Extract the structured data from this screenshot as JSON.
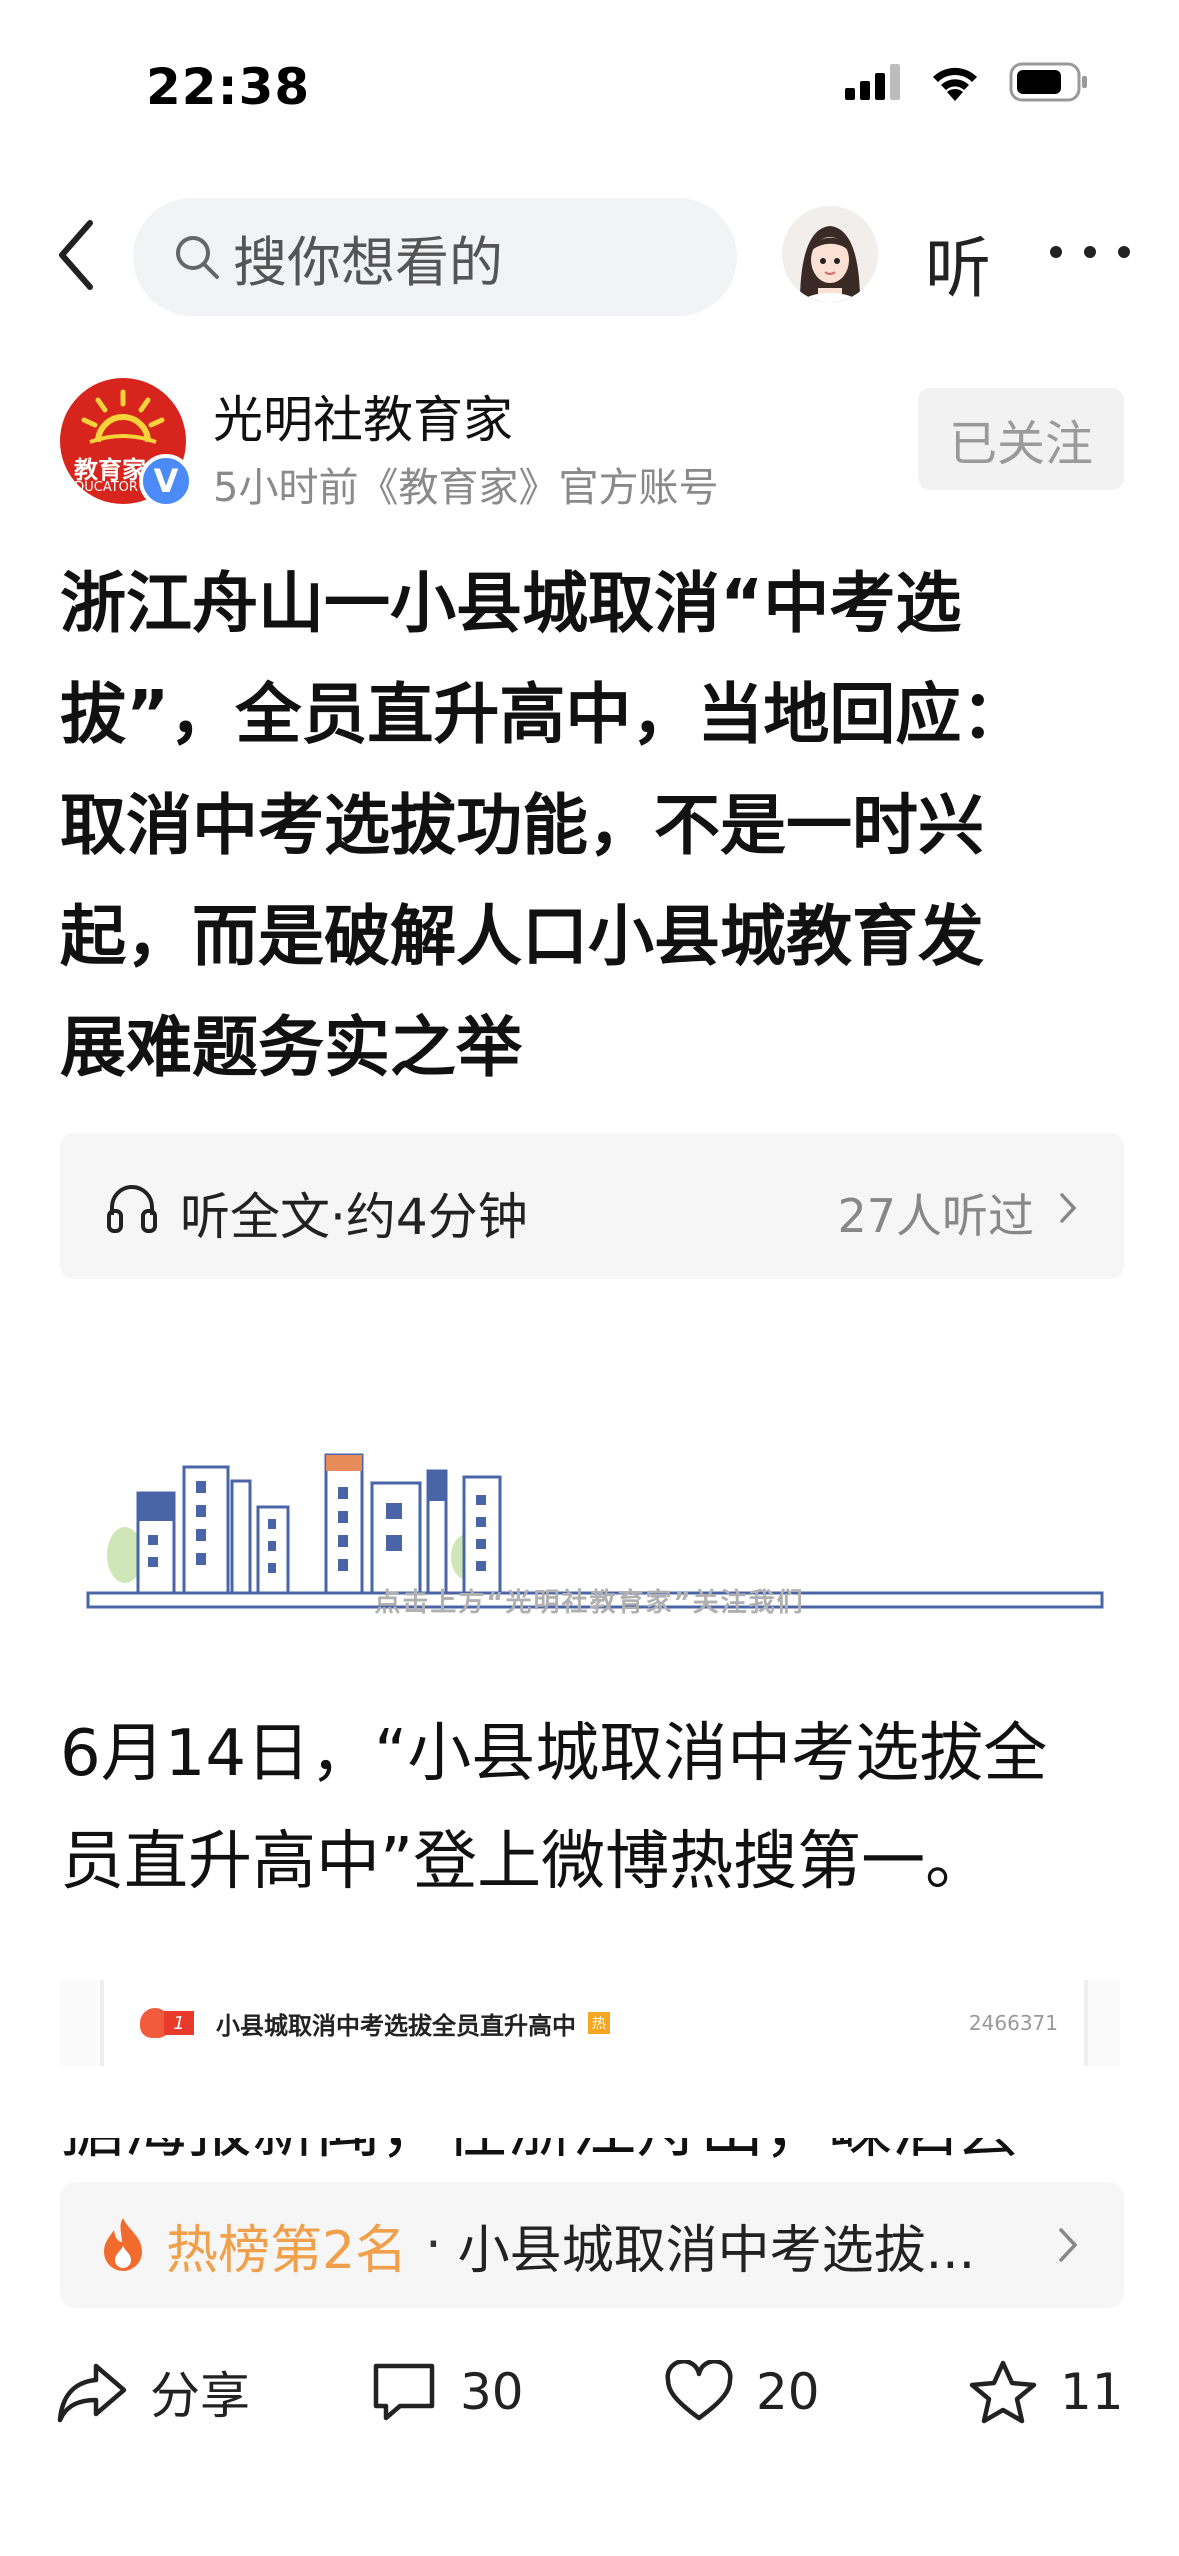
{
  "status_bar": {
    "time": "22:38"
  },
  "top_nav": {
    "search_placeholder": "搜你想看的",
    "listen_label": "听"
  },
  "author": {
    "logo_text": "教育家",
    "logo_sub": "EDUCATOR",
    "verify_mark": "V",
    "name": "光明社教育家",
    "meta": "5小时前《教育家》官方账号",
    "follow_label": "已关注"
  },
  "article": {
    "title_lines": [
      "浙江舟山一小县城取消“中考选",
      "拔”，全员直升高中，当地回应：",
      "取消中考选拔功能，不是一时兴",
      "起，而是破解人口小县城教育发",
      "展难题务实之举"
    ],
    "listen_bar": {
      "label": "听全文·约4分钟",
      "count": "27人听过"
    },
    "illustration_caption": "点击上方“光明社教育家”关注我们",
    "paragraph_lines": [
      "6月14日，“小县城取消中考选拔全",
      "员直升高中”登上微博热搜第一。"
    ],
    "hot_search": {
      "rank": "1",
      "text": "小县城取消中考选拔全员直升高中",
      "tag": "热",
      "views": "2466371"
    },
    "cut_line": "据海报新闻，在浙江舟山，嵊泗县"
  },
  "trending": {
    "rank_label": "热榜第2名",
    "separator": "·",
    "topic": "小县城取消中考选拔..."
  },
  "actions": {
    "share": "分享",
    "comments": "30",
    "likes": "20",
    "favorites": "11"
  },
  "colors": {
    "accent_orange": "#f0a04a",
    "logo_red": "#d7241c",
    "verify_blue": "#4b8af7",
    "building_blue": "#4a64a8"
  }
}
